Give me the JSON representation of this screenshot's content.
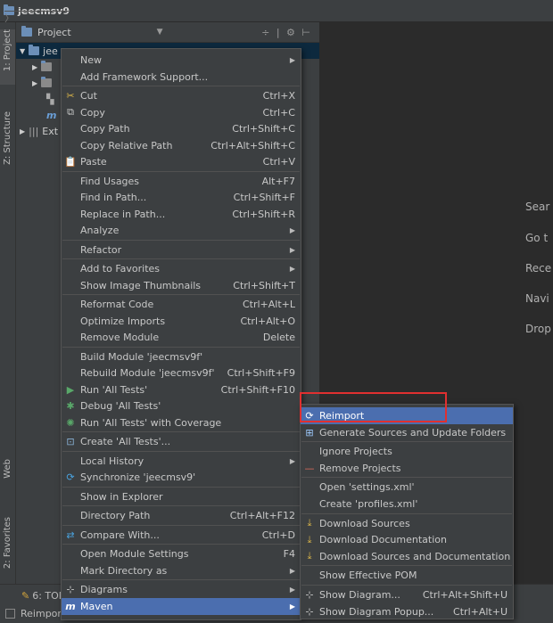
{
  "breadcrumb": {
    "project": "jeecmsv9"
  },
  "left_tabs": [
    "1: Project",
    "Z: Structure",
    "Web",
    "2: Favorites"
  ],
  "project_panel": {
    "title": "Project",
    "tree": [
      {
        "label": "jee",
        "expanded": true,
        "selected": true
      },
      {
        "label": ""
      },
      {
        "label": ""
      },
      {
        "label": ""
      },
      {
        "label": ""
      },
      {
        "label": "Ext"
      }
    ]
  },
  "editor_hints": [
    "Sear",
    "Go t",
    "Rece",
    "Navi",
    "Drop"
  ],
  "bottom": {
    "todo": "6: TOD",
    "status": "Reimpor"
  },
  "context_menu": [
    {
      "label": "New",
      "submenu": true
    },
    {
      "label": "Add Framework Support...",
      "sep_after": true
    },
    {
      "label": "Cut",
      "shortcut": "Ctrl+X",
      "icon": "cut-icon"
    },
    {
      "label": "Copy",
      "shortcut": "Ctrl+C",
      "icon": "copy-icon"
    },
    {
      "label": "Copy Path",
      "shortcut": "Ctrl+Shift+C"
    },
    {
      "label": "Copy Relative Path",
      "shortcut": "Ctrl+Alt+Shift+C"
    },
    {
      "label": "Paste",
      "shortcut": "Ctrl+V",
      "icon": "paste-icon",
      "sep_after": true
    },
    {
      "label": "Find Usages",
      "shortcut": "Alt+F7"
    },
    {
      "label": "Find in Path...",
      "shortcut": "Ctrl+Shift+F"
    },
    {
      "label": "Replace in Path...",
      "shortcut": "Ctrl+Shift+R"
    },
    {
      "label": "Analyze",
      "submenu": true,
      "sep_after": true
    },
    {
      "label": "Refactor",
      "submenu": true,
      "sep_after": true
    },
    {
      "label": "Add to Favorites",
      "submenu": true
    },
    {
      "label": "Show Image Thumbnails",
      "shortcut": "Ctrl+Shift+T",
      "sep_after": true
    },
    {
      "label": "Reformat Code",
      "shortcut": "Ctrl+Alt+L"
    },
    {
      "label": "Optimize Imports",
      "shortcut": "Ctrl+Alt+O"
    },
    {
      "label": "Remove Module",
      "shortcut": "Delete",
      "sep_after": true
    },
    {
      "label": "Build Module 'jeecmsv9f'"
    },
    {
      "label": "Rebuild Module 'jeecmsv9f'",
      "shortcut": "Ctrl+Shift+F9"
    },
    {
      "label": "Run 'All Tests'",
      "shortcut": "Ctrl+Shift+F10",
      "icon": "run-icon"
    },
    {
      "label": "Debug 'All Tests'",
      "icon": "debug-icon"
    },
    {
      "label": "Run 'All Tests' with Coverage",
      "icon": "coverage-icon",
      "sep_after": true
    },
    {
      "label": "Create 'All Tests'...",
      "icon": "test-icon",
      "sep_after": true
    },
    {
      "label": "Local History",
      "submenu": true
    },
    {
      "label": "Synchronize 'jeecmsv9'",
      "icon": "sync-icon",
      "sep_after": true
    },
    {
      "label": "Show in Explorer",
      "sep_after": true
    },
    {
      "label": "Directory Path",
      "shortcut": "Ctrl+Alt+F12",
      "sep_after": true
    },
    {
      "label": "Compare With...",
      "shortcut": "Ctrl+D",
      "icon": "compare-icon",
      "sep_after": true
    },
    {
      "label": "Open Module Settings",
      "shortcut": "F4"
    },
    {
      "label": "Mark Directory as",
      "submenu": true,
      "sep_after": true
    },
    {
      "label": "Diagrams",
      "submenu": true,
      "icon": "diagram-icon"
    },
    {
      "label": "Maven",
      "submenu": true,
      "icon": "maven-icon",
      "highlighted": true
    }
  ],
  "maven_submenu": [
    {
      "label": "Reimport",
      "icon": "reimport-icon",
      "highlighted": true
    },
    {
      "label": "Generate Sources and Update Folders",
      "icon": "generate-icon",
      "sep_after": true
    },
    {
      "label": "Ignore Projects"
    },
    {
      "label": "Remove Projects",
      "icon": "minus-icon",
      "sep_after": true
    },
    {
      "label": "Open 'settings.xml'"
    },
    {
      "label": "Create 'profiles.xml'",
      "sep_after": true
    },
    {
      "label": "Download Sources",
      "icon": "download-icon"
    },
    {
      "label": "Download Documentation",
      "icon": "download-icon"
    },
    {
      "label": "Download Sources and Documentation",
      "icon": "download-icon",
      "sep_after": true
    },
    {
      "label": "Show Effective POM",
      "sep_after": true
    },
    {
      "label": "Show Diagram...",
      "shortcut": "Ctrl+Alt+Shift+U",
      "icon": "diagram-icon"
    },
    {
      "label": "Show Diagram Popup...",
      "shortcut": "Ctrl+Alt+U",
      "icon": "diagram-icon"
    }
  ],
  "colors": {
    "highlight": "#4b6eaf",
    "annotation": "#e03030"
  }
}
